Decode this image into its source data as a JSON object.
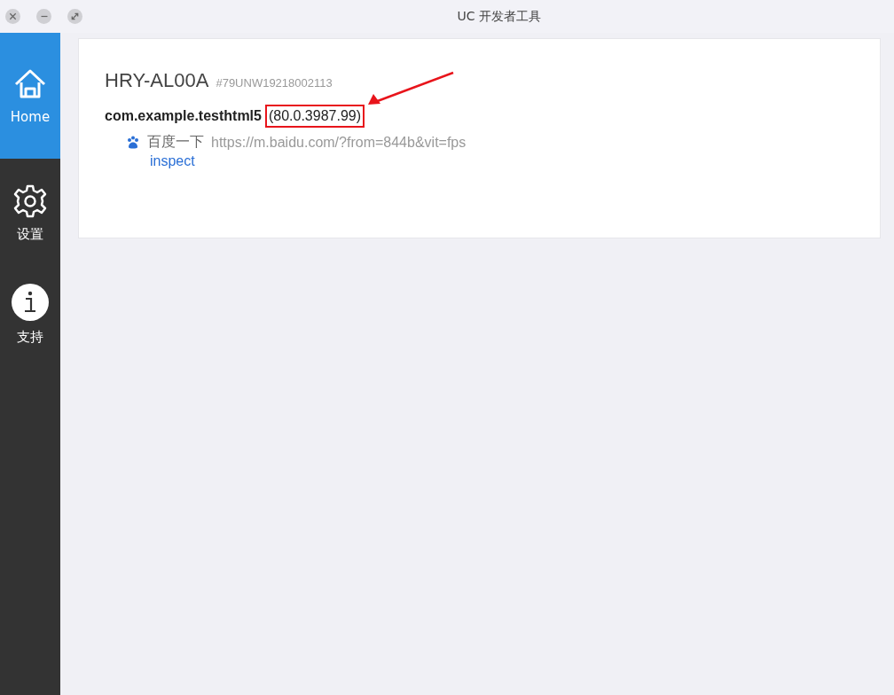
{
  "window": {
    "title": "UC 开发者工具"
  },
  "sidebar": {
    "items": [
      {
        "kind": "home",
        "label": "Home",
        "selected": true
      },
      {
        "kind": "settings",
        "label": "设置",
        "selected": false
      },
      {
        "kind": "info",
        "label": "支持",
        "selected": false
      }
    ]
  },
  "device": {
    "name": "HRY-AL00A",
    "serial": "#79UNW19218002113",
    "app": {
      "package": "com.example.testhtml5",
      "version": "(80.0.3987.99)",
      "version_highlighted": true
    },
    "pages": [
      {
        "title": "百度一下",
        "url": "https://m.baidu.com/?from=844b&vit=fps",
        "action": "inspect"
      }
    ]
  }
}
